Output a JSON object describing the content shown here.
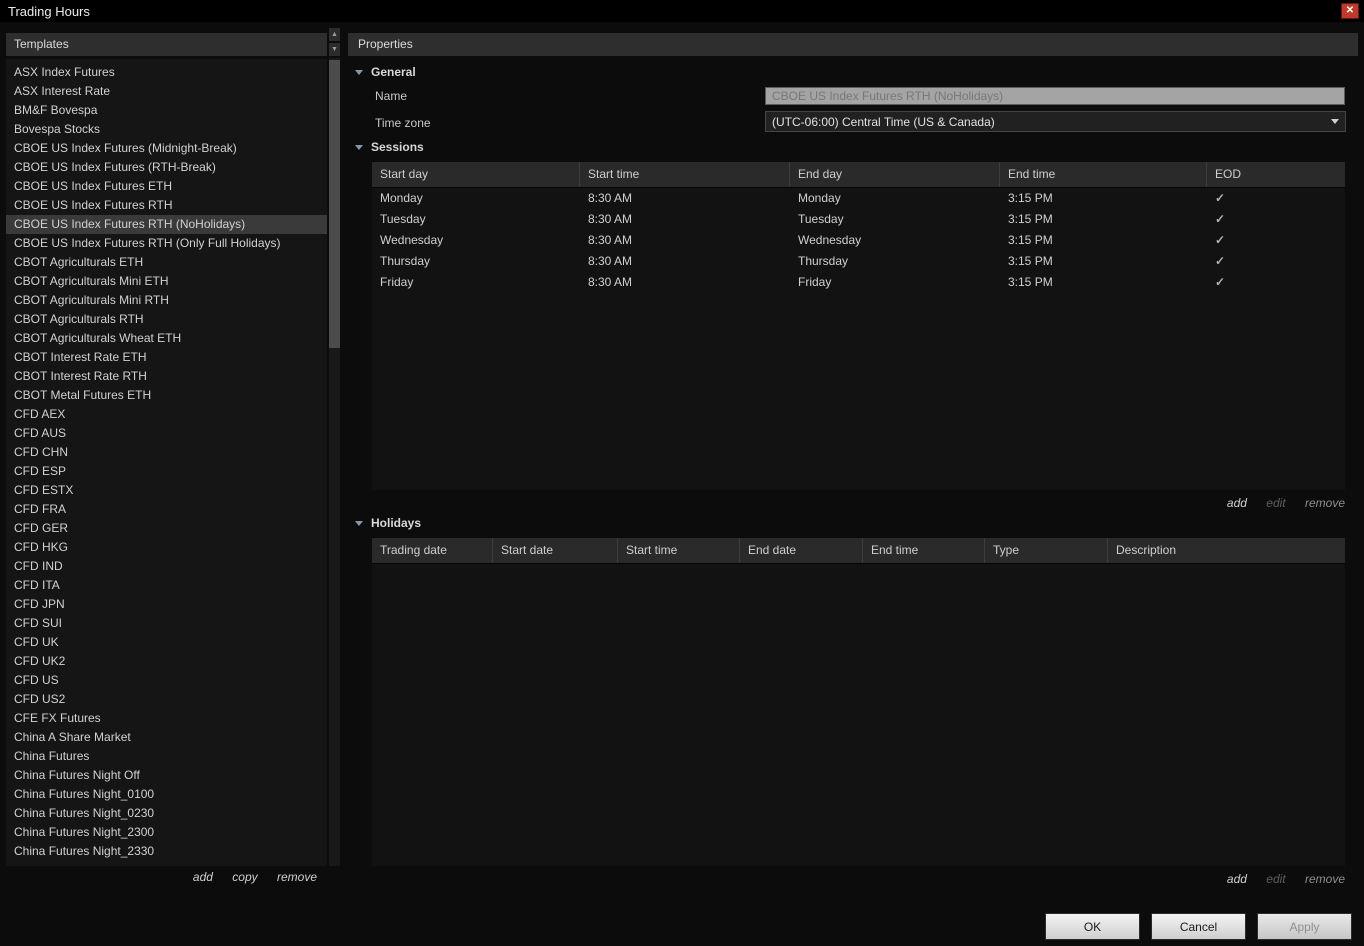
{
  "window": {
    "title": "Trading Hours"
  },
  "templates": {
    "header": "Templates",
    "selected": "CBOE US Index Futures RTH (NoHolidays)",
    "items": [
      "ASX Index Futures",
      "ASX Interest Rate",
      "BM&F Bovespa",
      "Bovespa Stocks",
      "CBOE US Index Futures (Midnight-Break)",
      "CBOE US Index Futures (RTH-Break)",
      "CBOE US Index Futures ETH",
      "CBOE US Index Futures RTH",
      "CBOE US Index Futures RTH (NoHolidays)",
      "CBOE US Index Futures RTH (Only Full Holidays)",
      "CBOT Agriculturals ETH",
      "CBOT Agriculturals Mini ETH",
      "CBOT Agriculturals Mini RTH",
      "CBOT Agriculturals RTH",
      "CBOT Agriculturals Wheat ETH",
      "CBOT Interest Rate ETH",
      "CBOT Interest Rate RTH",
      "CBOT Metal Futures ETH",
      "CFD AEX",
      "CFD AUS",
      "CFD CHN",
      "CFD ESP",
      "CFD ESTX",
      "CFD FRA",
      "CFD GER",
      "CFD HKG",
      "CFD IND",
      "CFD ITA",
      "CFD JPN",
      "CFD SUI",
      "CFD UK",
      "CFD UK2",
      "CFD US",
      "CFD US2",
      "CFE FX Futures",
      "China A Share Market",
      "China Futures",
      "China Futures Night Off",
      "China Futures Night_0100",
      "China Futures Night_0230",
      "China Futures Night_2300",
      "China Futures Night_2330"
    ],
    "actions": {
      "add": "add",
      "copy": "copy",
      "remove": "remove"
    }
  },
  "properties": {
    "header": "Properties",
    "general": {
      "title": "General",
      "name_label": "Name",
      "name_value": "CBOE US Index Futures RTH (NoHolidays)",
      "timezone_label": "Time zone",
      "timezone_value": "(UTC-06:00) Central Time (US & Canada)"
    },
    "sessions": {
      "title": "Sessions",
      "columns": [
        "Start day",
        "Start time",
        "End day",
        "End time",
        "EOD"
      ],
      "rows": [
        {
          "start_day": "Monday",
          "start_time": "8:30 AM",
          "end_day": "Monday",
          "end_time": "3:15 PM",
          "eod": true
        },
        {
          "start_day": "Tuesday",
          "start_time": "8:30 AM",
          "end_day": "Tuesday",
          "end_time": "3:15 PM",
          "eod": true
        },
        {
          "start_day": "Wednesday",
          "start_time": "8:30 AM",
          "end_day": "Wednesday",
          "end_time": "3:15 PM",
          "eod": true
        },
        {
          "start_day": "Thursday",
          "start_time": "8:30 AM",
          "end_day": "Thursday",
          "end_time": "3:15 PM",
          "eod": true
        },
        {
          "start_day": "Friday",
          "start_time": "8:30 AM",
          "end_day": "Friday",
          "end_time": "3:15 PM",
          "eod": true
        }
      ],
      "actions": {
        "add": "add",
        "edit": "edit",
        "remove": "remove"
      }
    },
    "holidays": {
      "title": "Holidays",
      "columns": [
        "Trading date",
        "Start date",
        "Start time",
        "End date",
        "End time",
        "Type",
        "Description"
      ],
      "rows": [],
      "actions": {
        "add": "add",
        "edit": "edit",
        "remove": "remove"
      }
    }
  },
  "footer": {
    "ok": "OK",
    "cancel": "Cancel",
    "apply": "Apply"
  },
  "colors": {
    "close_button": "#c03a2b",
    "selection": "#3a3a3a",
    "panel_header": "#2e2e2e"
  }
}
